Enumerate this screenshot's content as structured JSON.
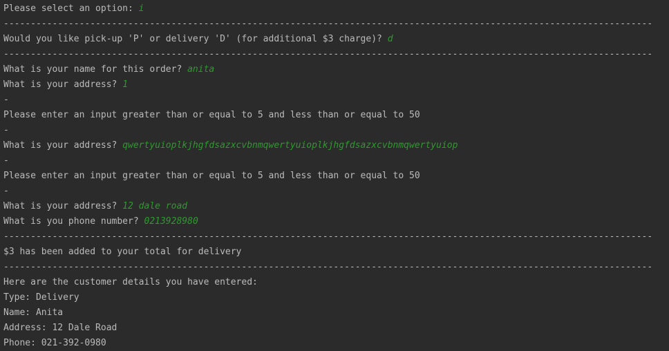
{
  "console": {
    "separator": "------------------------------------------------------------------------------------------------------------------------",
    "lines": [
      {
        "prompt": "Please select an option: ",
        "input": "i"
      },
      {
        "separator": true
      },
      {
        "prompt": "Would you like pick-up 'P' or delivery 'D' (for additional $3 charge)? ",
        "input": "d"
      },
      {
        "separator": true
      },
      {
        "prompt": "What is your name for this order? ",
        "input": "anita"
      },
      {
        "prompt": "What is your address? ",
        "input": "1"
      },
      {
        "prompt": "-",
        "input": ""
      },
      {
        "prompt": "Please enter an input greater than or equal to 5 and less than or equal to 50",
        "input": ""
      },
      {
        "prompt": "-",
        "input": ""
      },
      {
        "prompt": "What is your address? ",
        "input": "qwertyuioplkjhgfdsazxcvbnmqwertyuioplkjhgfdsazxcvbnmqwertyuiop"
      },
      {
        "prompt": "-",
        "input": ""
      },
      {
        "prompt": "Please enter an input greater than or equal to 5 and less than or equal to 50",
        "input": ""
      },
      {
        "prompt": "-",
        "input": ""
      },
      {
        "prompt": "What is your address? ",
        "input": "12 dale road"
      },
      {
        "prompt": "What is you phone number? ",
        "input": "0213928980"
      },
      {
        "separator": true
      },
      {
        "prompt": "$3 has been added to your total for delivery",
        "input": ""
      },
      {
        "separator": true
      },
      {
        "prompt": "Here are the customer details you have entered:",
        "input": ""
      },
      {
        "prompt": "Type: Delivery",
        "input": ""
      },
      {
        "prompt": "Name: Anita",
        "input": ""
      },
      {
        "prompt": "Address: 12 Dale Road",
        "input": ""
      },
      {
        "prompt": "Phone: 021-392-0980",
        "input": ""
      }
    ]
  },
  "colors": {
    "background": "#2b2b2b",
    "text": "#bbbbbb",
    "user_input": "#2e9a2e"
  }
}
